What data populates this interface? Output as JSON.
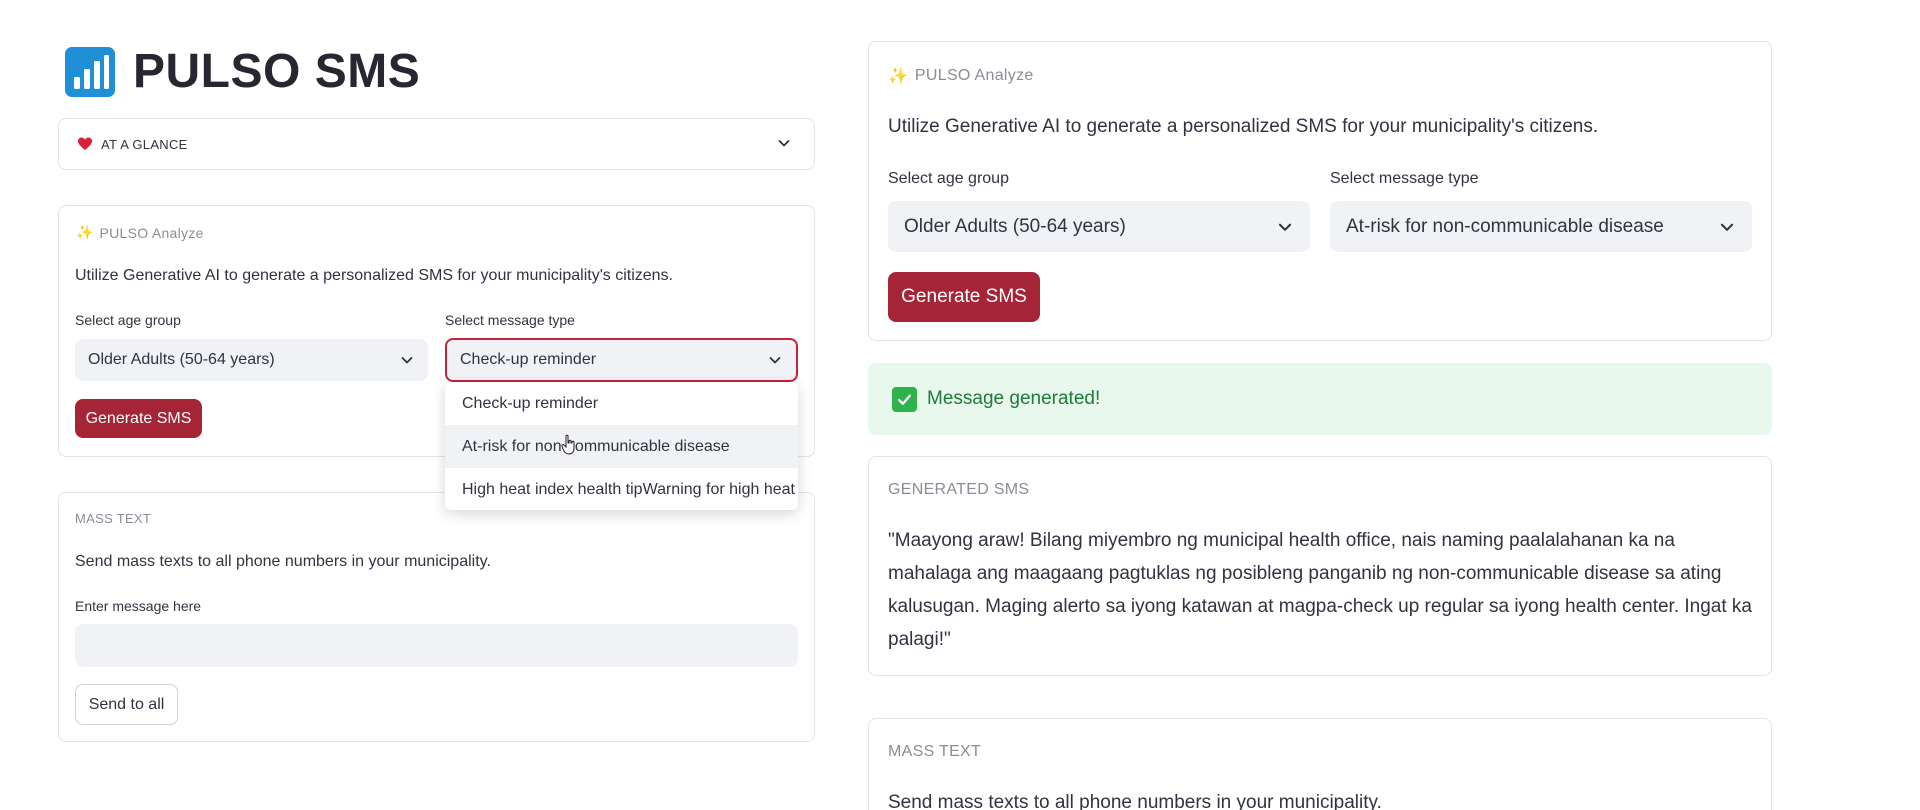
{
  "app": {
    "title": "PULSO SMS"
  },
  "at_a_glance": {
    "label": "AT A GLANCE",
    "icon": "heart-icon"
  },
  "left_analyze": {
    "section_title": "PULSO Analyze",
    "description": "Utilize Generative AI to generate a personalized SMS for your municipality's citizens.",
    "age_label": "Select age group",
    "age_value": "Older Adults (50-64 years)",
    "type_label": "Select message type",
    "type_value": "Check-up reminder",
    "generate_label": "Generate SMS",
    "dropdown_options": [
      "Check-up reminder",
      "At-risk for non-communicable disease",
      "High heat index health tipWarning for high heat index"
    ]
  },
  "left_mass": {
    "section_title": "MASS TEXT",
    "description": "Send mass texts to all phone numbers in your municipality.",
    "input_label": "Enter message here",
    "input_value": "",
    "send_label": "Send to all"
  },
  "right_analyze": {
    "section_title": "PULSO Analyze",
    "description": "Utilize Generative AI to generate a personalized SMS for your municipality's citizens.",
    "age_label": "Select age group",
    "age_value": "Older Adults (50-64 years)",
    "type_label": "Select message type",
    "type_value": "At-risk for non-communicable disease",
    "generate_label": "Generate SMS"
  },
  "success": {
    "message": "Message generated!"
  },
  "generated": {
    "title": "GENERATED SMS",
    "body": "\"Maayong araw! Bilang miyembro ng municipal health office, nais naming paalalahanan ka na mahalaga ang maagaang pagtuklas ng posibleng panganib ng non-communicable disease sa ating kalusugan. Maging alerto sa iyong katawan at magpa-check up regular sa iyong health center. Ingat ka palagi!\""
  },
  "right_mass": {
    "section_title": "MASS TEXT",
    "description": "Send mass texts to all phone numbers in your municipality."
  },
  "colors": {
    "primary_button": "#a52537",
    "logo_blue": "#1f8fd6",
    "success_bg": "#e8f8ec",
    "success_text": "#1f7a3a"
  }
}
